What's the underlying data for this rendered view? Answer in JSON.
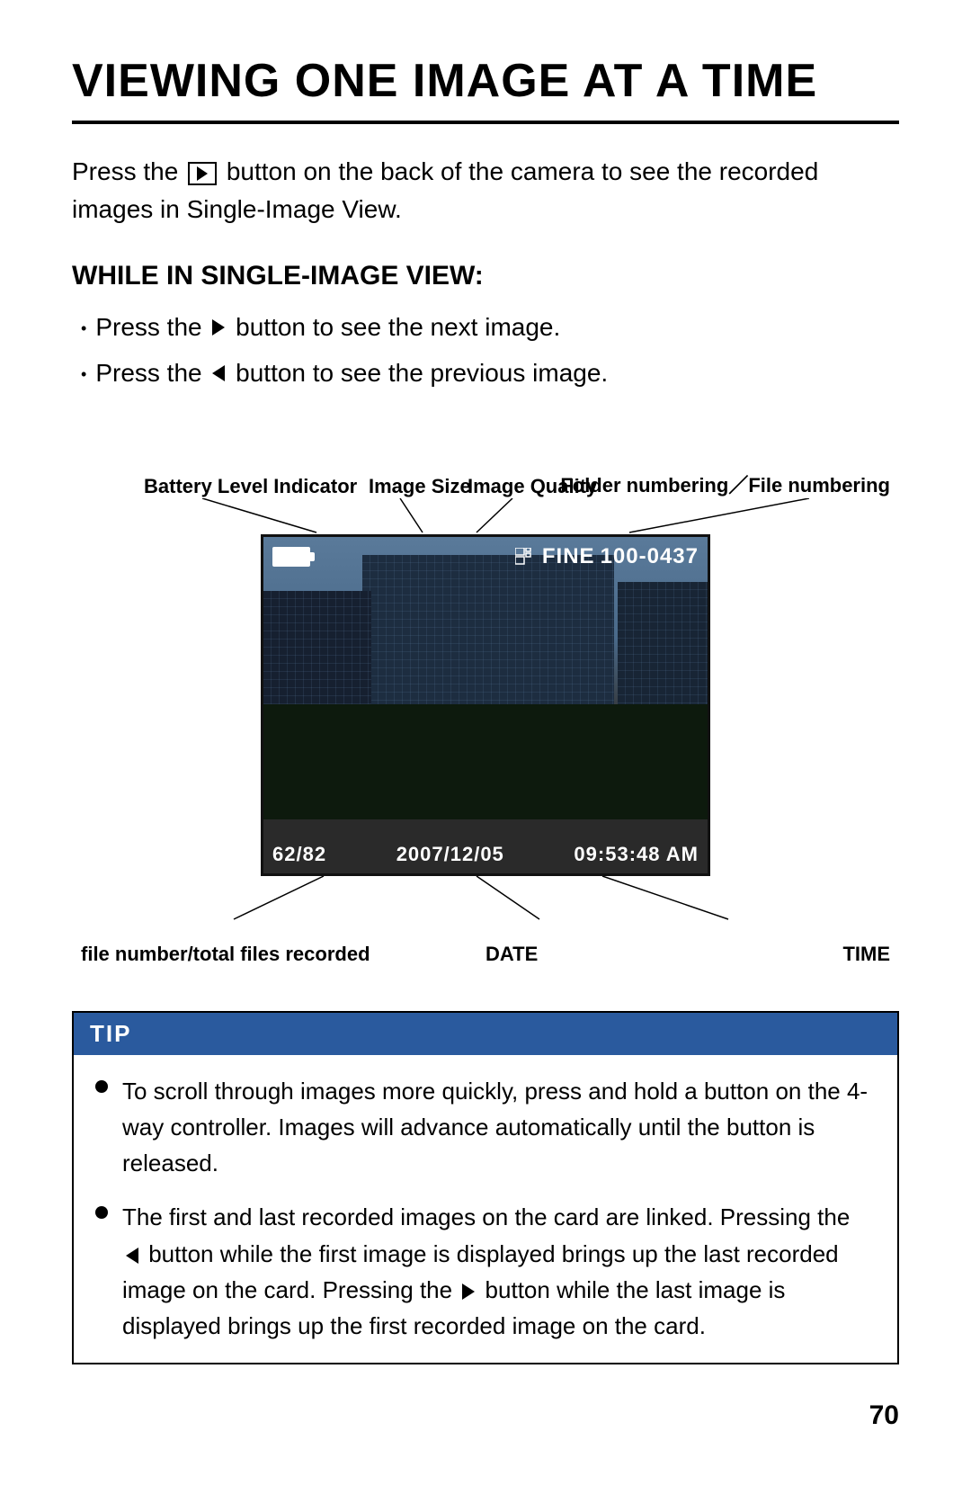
{
  "page": {
    "title": "VIEWING ONE IMAGE AT A TIME",
    "page_number": "70"
  },
  "intro": {
    "text_before": "Press the",
    "icon_desc": "playback-button",
    "text_after": "button on the back of the camera to see the recorded images in Single-Image View."
  },
  "single_image_view": {
    "heading": "WHILE IN SINGLE-IMAGE VIEW:",
    "bullets": [
      {
        "text_before": "Press the",
        "icon": "right-arrow",
        "text_after": "button to see the next image."
      },
      {
        "text_before": "Press the",
        "icon": "left-arrow",
        "text_after": "button to see the previous image."
      }
    ]
  },
  "diagram": {
    "top_labels": [
      {
        "id": "battery",
        "text": "Battery Level Indicator"
      },
      {
        "id": "image_size",
        "text": "Image Size"
      },
      {
        "id": "image_quality",
        "text": "Image Quality"
      },
      {
        "id": "folder_file",
        "text": "Folder numbering／File numbering"
      }
    ],
    "screen": {
      "top_left": "battery-icon",
      "top_right_quality": "FINE",
      "top_right_number": "100-0437",
      "bottom_left": "62/82",
      "bottom_center": "2007/12/05",
      "bottom_right": "09:53:48 AM"
    },
    "bottom_labels": [
      {
        "id": "file_number",
        "text": "file number/total files recorded"
      },
      {
        "id": "date",
        "text": "DATE"
      },
      {
        "id": "time",
        "text": "TIME"
      }
    ]
  },
  "tip": {
    "header": "TIP",
    "bullets": [
      "To scroll through images more quickly, press and hold a button on the 4-way controller.   Images will advance automatically until the button is released.",
      "The first and last recorded images on the card are linked. Pressing the ◀ button while the first image is displayed brings up the last recorded image on the card. Pressing the ▶ button while the last image is displayed brings up the first recorded image on the card."
    ]
  }
}
